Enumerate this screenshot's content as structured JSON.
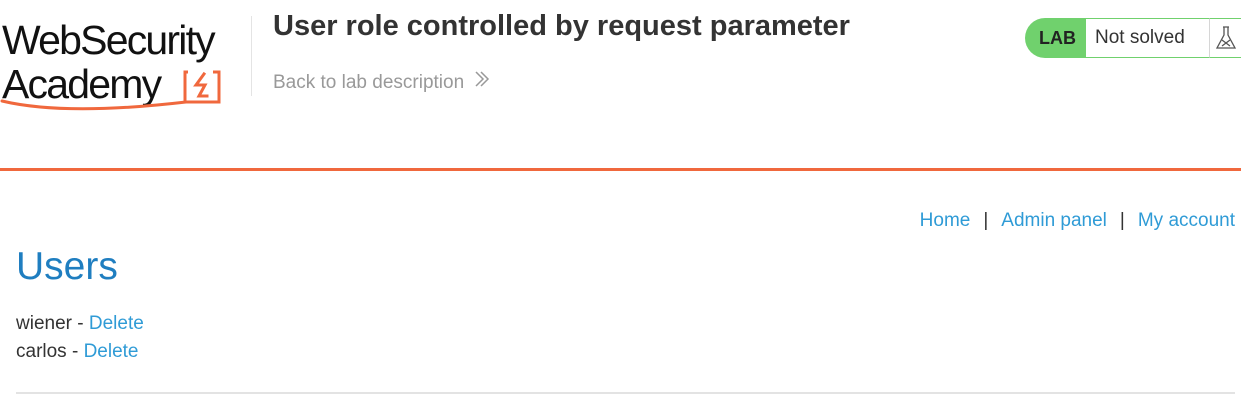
{
  "logo": {
    "line1": "WebSecurity",
    "line2": "Academy",
    "accent_color": "#f0683d",
    "icon": "bolt-icon"
  },
  "header": {
    "title": "User role controlled by request parameter",
    "back_link": "Back to lab description",
    "back_icon": "double-chevron-right-icon"
  },
  "status": {
    "badge": "LAB",
    "state": "Not solved",
    "badge_color": "#70d16d",
    "icon": "flask-icon"
  },
  "nav": {
    "home": "Home",
    "separator1": "|",
    "admin_panel": "Admin panel",
    "separator2": "|",
    "my_account": "My account"
  },
  "page": {
    "heading": "Users"
  },
  "users": [
    {
      "name": "wiener",
      "separator": "-",
      "action": "Delete"
    },
    {
      "name": "carlos",
      "separator": "-",
      "action": "Delete"
    }
  ],
  "colors": {
    "link": "#2f9bd6",
    "heading": "#1f7ec0",
    "rule": "#f0683d"
  }
}
